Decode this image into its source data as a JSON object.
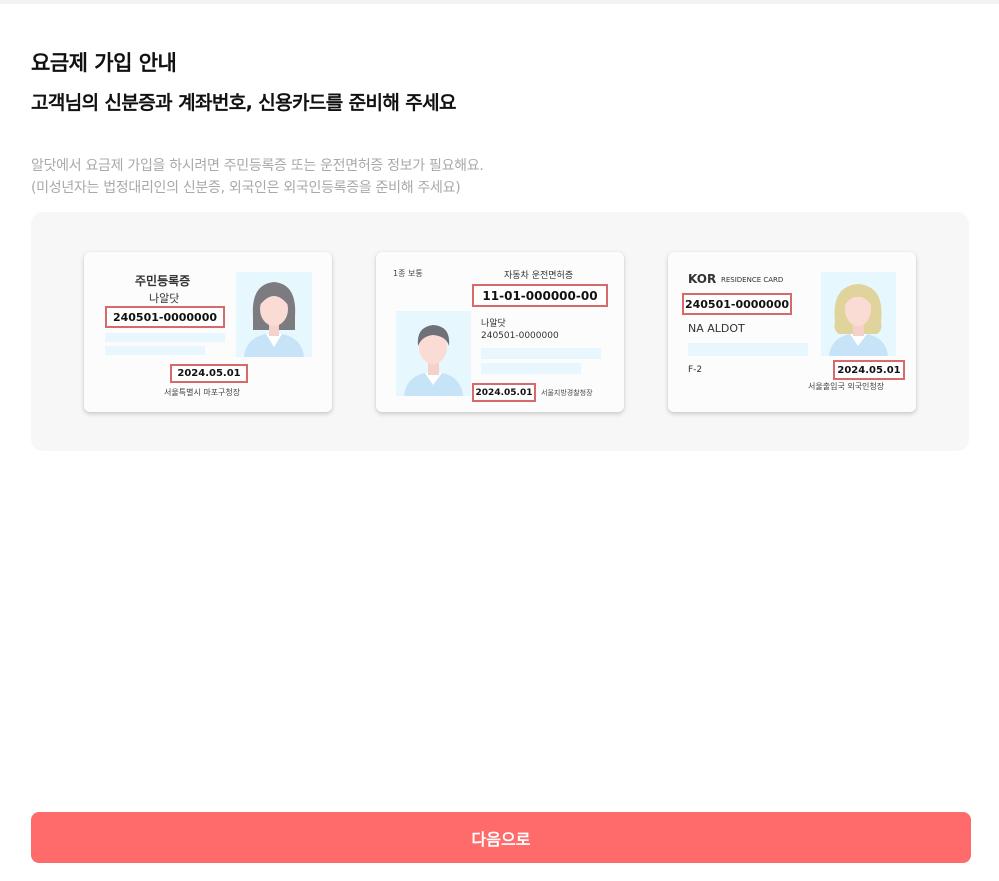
{
  "header": {
    "title": "요금제 가입 안내",
    "subtitle": "고객님의 신분증과 계좌번호, 신용카드를 준비해 주세요"
  },
  "description": {
    "line1": "알닷에서 요금제 가입을 하시려면 주민등록증 또는 운전면허증 정보가 필요해요.",
    "line2": "(미성년자는 법정대리인의 신분증, 외국인은 외국인등록증을 준비해 주세요)"
  },
  "cards": {
    "resident": {
      "title": "주민등록증",
      "name": "나알닷",
      "id_number": "240501-0000000",
      "date": "2024.05.01",
      "issuer": "서울특별시 마포구청장"
    },
    "license": {
      "type": "1종 보통",
      "title": "자동차 운전면허증",
      "license_number": "11-01-000000-00",
      "name": "나알닷",
      "id_number": "240501-0000000",
      "date": "2024.05.01",
      "issuer": "서울지방경찰청장"
    },
    "foreign": {
      "country": "KOR",
      "card_title": "RESIDENCE CARD",
      "id_number": "240501-0000000",
      "name": "NA ALDOT",
      "visa": "F-2",
      "date": "2024.05.01",
      "issuer": "서울출입국 외국인청장"
    }
  },
  "footer": {
    "next_label": "다음으로"
  },
  "colors": {
    "accent": "#ff6b6b",
    "highlight_border": "#d8696b",
    "panel_bg": "#f7f7f7",
    "photo_bg": "#e6f7fd",
    "muted_text": "#a9a9a9"
  }
}
